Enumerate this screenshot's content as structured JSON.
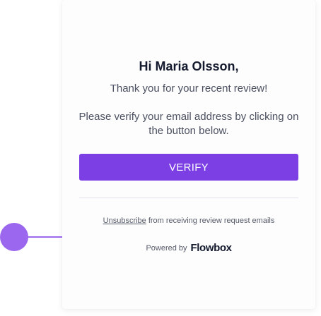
{
  "email": {
    "greeting": "Hi Maria Olsson,",
    "thanks": "Thank you for your recent review!",
    "instructions": "Please verify your email address by clicking on the button below.",
    "verify_label": "VERIFY"
  },
  "footer": {
    "unsubscribe_link": "Unsubscribe",
    "unsubscribe_text": " from receiving review request emails",
    "powered_by": "Powered by",
    "brand": "Flowbox"
  },
  "colors": {
    "accent": "#7b3fe4",
    "decoration": "#9a67ee",
    "heading": "#141a2e",
    "body_text": "#4b5060"
  }
}
